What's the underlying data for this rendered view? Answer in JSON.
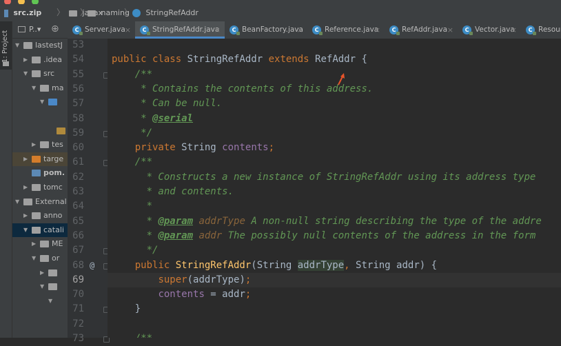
{
  "navbar": {
    "crumbs": [
      {
        "label": "src.zip",
        "icon": "zip-icon"
      },
      {
        "label": "javax",
        "icon": "package-icon"
      },
      {
        "label": "naming",
        "icon": "package-icon"
      },
      {
        "label": "StringRefAddr",
        "icon": "class-icon"
      }
    ]
  },
  "sidestrip": {
    "label": "1: Project"
  },
  "project": {
    "header": "P..▾",
    "rows": [
      {
        "label": "lastestJ",
        "expanded": true,
        "icon": "folder-icon"
      },
      {
        "label": ".idea",
        "expanded": false,
        "icon": "folder-icon"
      },
      {
        "label": "src",
        "expanded": true,
        "icon": "folder-icon"
      },
      {
        "label": "ma",
        "expanded": true,
        "icon": "folder-icon"
      },
      {
        "label": "",
        "expanded": true,
        "icon": "folder-blue-icon"
      },
      {
        "label": "",
        "expanded": null,
        "icon": ""
      },
      {
        "label": "",
        "expanded": null,
        "icon": "file-icon"
      },
      {
        "label": "tes",
        "expanded": false,
        "icon": "folder-icon"
      },
      {
        "label": "targe",
        "expanded": false,
        "icon": "folder-orange-icon"
      },
      {
        "label": "pom.",
        "expanded": null,
        "icon": "maven-icon"
      },
      {
        "label": "tomc",
        "expanded": false,
        "icon": "library-icon"
      },
      {
        "label": "External",
        "expanded": true,
        "icon": "libraries-icon"
      },
      {
        "label": "anno",
        "expanded": false,
        "icon": "jar-icon"
      },
      {
        "label": "catali",
        "expanded": true,
        "icon": "jar-icon"
      },
      {
        "label": "ME",
        "expanded": false,
        "icon": "package-icon"
      },
      {
        "label": "or",
        "expanded": true,
        "icon": "package-icon"
      },
      {
        "label": "",
        "expanded": false,
        "icon": "package-icon"
      },
      {
        "label": "",
        "expanded": true,
        "icon": "package-icon"
      },
      {
        "label": "",
        "expanded": true,
        "icon": ""
      }
    ]
  },
  "tabs": [
    {
      "label": "Server.java",
      "active": false
    },
    {
      "label": "StringRefAddr.java",
      "active": true
    },
    {
      "label": "BeanFactory.java",
      "active": false
    },
    {
      "label": "Reference.java",
      "active": false
    },
    {
      "label": "RefAddr.java",
      "active": false
    },
    {
      "label": "Vector.java",
      "active": false
    },
    {
      "label": "Resourc",
      "active": false
    }
  ],
  "editor": {
    "current_line": 69,
    "line_numbers": [
      "53",
      "54",
      "55",
      "56",
      "57",
      "58",
      "59",
      "60",
      "61",
      "62",
      "63",
      "64",
      "65",
      "66",
      "67",
      "68",
      "69",
      "70",
      "71",
      "72",
      "73"
    ],
    "override_marker": "@",
    "lines": [
      [],
      [
        {
          "t": "public class ",
          "c": "kw"
        },
        {
          "t": "StringRefAddr ",
          "c": ""
        },
        {
          "t": "extends ",
          "c": "kw"
        },
        {
          "t": "RefAddr {",
          "c": ""
        }
      ],
      [
        {
          "t": "    /**",
          "c": "cm"
        }
      ],
      [
        {
          "t": "     * Contains the contents of this address.",
          "c": "cm"
        }
      ],
      [
        {
          "t": "     * Can be null.",
          "c": "cm"
        }
      ],
      [
        {
          "t": "     * ",
          "c": "cm"
        },
        {
          "t": "@serial",
          "c": "tag"
        }
      ],
      [
        {
          "t": "     */",
          "c": "cm"
        }
      ],
      [
        {
          "t": "    private ",
          "c": "kw"
        },
        {
          "t": "String ",
          "c": ""
        },
        {
          "t": "contents",
          "c": "fld"
        },
        {
          "t": ";",
          "c": "kw"
        }
      ],
      [
        {
          "t": "    /**",
          "c": "cm"
        }
      ],
      [
        {
          "t": "      * Constructs a new instance of StringRefAddr using its address type",
          "c": "cm"
        }
      ],
      [
        {
          "t": "      * and contents.",
          "c": "cm"
        }
      ],
      [
        {
          "t": "      *",
          "c": "cm"
        }
      ],
      [
        {
          "t": "      * ",
          "c": "cm"
        },
        {
          "t": "@param",
          "c": "tag"
        },
        {
          "t": " ",
          "c": "cm"
        },
        {
          "t": "addrType",
          "c": "par"
        },
        {
          "t": " A non-null string describing the type of the addre",
          "c": "cm"
        }
      ],
      [
        {
          "t": "      * ",
          "c": "cm"
        },
        {
          "t": "@param",
          "c": "tag"
        },
        {
          "t": " ",
          "c": "cm"
        },
        {
          "t": "addr",
          "c": "par"
        },
        {
          "t": " The possibly null contents of the address in the form",
          "c": "cm"
        }
      ],
      [
        {
          "t": "      */",
          "c": "cm"
        }
      ],
      [
        {
          "t": "    public ",
          "c": "kw"
        },
        {
          "t": "StringRefAddr",
          "c": "fn"
        },
        {
          "t": "(String ",
          "c": ""
        },
        {
          "t": "addrType",
          "c": "hlp"
        },
        {
          "t": ", ",
          "c": "kw"
        },
        {
          "t": "String addr) {",
          "c": ""
        }
      ],
      [
        {
          "t": "        ",
          "c": ""
        },
        {
          "t": "super",
          "c": "kw"
        },
        {
          "t": "(addrType)",
          "c": ""
        },
        {
          "t": ";",
          "c": "kw"
        }
      ],
      [
        {
          "t": "        ",
          "c": ""
        },
        {
          "t": "contents",
          "c": "fld"
        },
        {
          "t": " = addr",
          "c": ""
        },
        {
          "t": ";",
          "c": "kw"
        }
      ],
      [
        {
          "t": "    }",
          "c": ""
        }
      ],
      [],
      [
        {
          "t": "    /**",
          "c": "cm"
        }
      ]
    ]
  },
  "colors": {
    "accent": "#4a88c7",
    "annotation_arrow": "#e8542a"
  }
}
